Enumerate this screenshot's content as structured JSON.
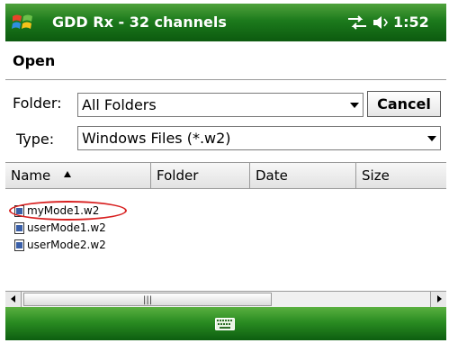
{
  "titlebar": {
    "title": "GDD Rx - 32 channels",
    "time": "1:52",
    "icons": [
      "windows-start-icon",
      "connectivity-icon",
      "volume-icon"
    ]
  },
  "dialog": {
    "heading": "Open",
    "folder_label": "Folder:",
    "folder_value": "All Folders",
    "type_label": "Type:",
    "type_value": "Windows Files (*.w2)",
    "cancel_label": "Cancel"
  },
  "list": {
    "columns": [
      "Name",
      "Folder",
      "Date",
      "Size"
    ],
    "sort_column": "Name",
    "sort_direction": "ascending",
    "files": [
      "myMode1.w2",
      "userMode1.w2",
      "userMode2.w2"
    ],
    "highlighted_file": "myMode1.w2"
  },
  "scrollbar": {
    "position": 0.0
  },
  "menubar": {
    "icons": [
      "keyboard-icon"
    ]
  },
  "colors": {
    "bar_green_light": "#4fa23c",
    "bar_green_dark": "#0c5a0f",
    "highlight_red": "#d82020"
  }
}
